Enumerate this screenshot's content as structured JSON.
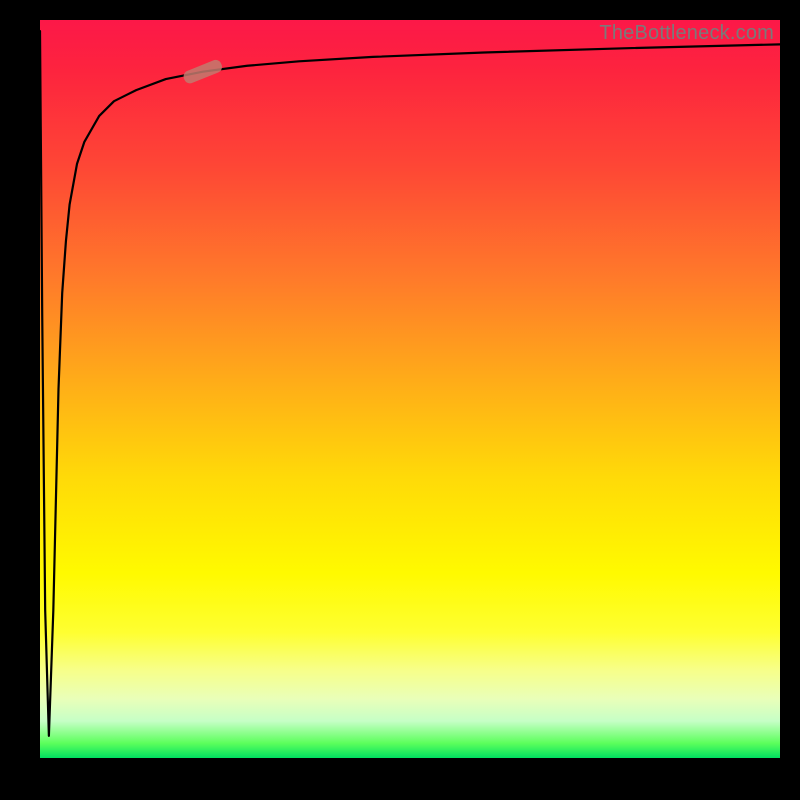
{
  "watermark": "TheBottleneck.com",
  "chart_data": {
    "type": "line",
    "title": "",
    "xlabel": "",
    "ylabel": "",
    "xlim": [
      0,
      100
    ],
    "ylim": [
      0,
      100
    ],
    "background_gradient": {
      "direction": "top-to-bottom",
      "stops": [
        {
          "pos": 0.0,
          "color": "#FC1848"
        },
        {
          "pos": 0.07,
          "color": "#FD243E"
        },
        {
          "pos": 0.2,
          "color": "#FE4735"
        },
        {
          "pos": 0.35,
          "color": "#FF7A2A"
        },
        {
          "pos": 0.5,
          "color": "#FFB017"
        },
        {
          "pos": 0.62,
          "color": "#FFDA08"
        },
        {
          "pos": 0.75,
          "color": "#FFFA00"
        },
        {
          "pos": 0.83,
          "color": "#FEFF31"
        },
        {
          "pos": 0.88,
          "color": "#F7FF88"
        },
        {
          "pos": 0.92,
          "color": "#E9FFB9"
        },
        {
          "pos": 0.95,
          "color": "#C6FFC6"
        },
        {
          "pos": 0.98,
          "color": "#5CFF5C"
        },
        {
          "pos": 1.0,
          "color": "#00E060"
        }
      ]
    },
    "series": [
      {
        "name": "bottleneck-curve",
        "color": "#000000",
        "x": [
          0.0,
          0.3,
          0.7,
          1.2,
          1.8,
          2.5,
          3.0,
          3.5,
          4.0,
          5.0,
          6.0,
          8.0,
          10.0,
          13.0,
          17.0,
          22.0,
          28.0,
          35.0,
          45.0,
          60.0,
          80.0,
          100.0
        ],
        "y": [
          98.5,
          60.0,
          20.0,
          3.0,
          20.0,
          50.0,
          63.0,
          70.0,
          75.0,
          80.5,
          83.5,
          87.0,
          89.0,
          90.5,
          92.0,
          93.0,
          93.8,
          94.4,
          95.0,
          95.6,
          96.2,
          96.7
        ]
      }
    ],
    "marker": {
      "series": "bottleneck-curve",
      "x": 22.0,
      "y": 93.0,
      "shape": "pill",
      "color": "#C27A6E",
      "angle_deg": 22
    }
  }
}
